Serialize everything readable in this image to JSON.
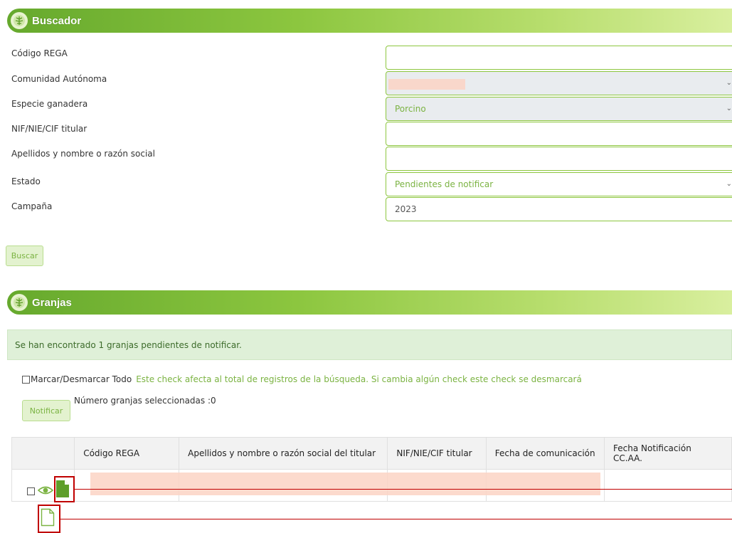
{
  "buscador": {
    "title": "Buscador",
    "fields": [
      {
        "label": "Código REGA",
        "value": "",
        "type": "text"
      },
      {
        "label": "Comunidad Autónoma",
        "value": "",
        "type": "select"
      },
      {
        "label": "Especie ganadera",
        "value": "Porcino",
        "type": "select"
      },
      {
        "label": "NIF/NIE/CIF titular",
        "value": "",
        "type": "text"
      },
      {
        "label": "Apellidos y nombre o razón social",
        "value": "",
        "type": "text"
      },
      {
        "label": "Estado",
        "value": "Pendientes de notificar",
        "type": "select"
      },
      {
        "label": "Campaña",
        "value": "2023",
        "type": "text"
      }
    ],
    "search_button": "Buscar"
  },
  "granjas": {
    "title": "Granjas",
    "alert": "Se han encontrado 1 granjas pendientes de notificar.",
    "toggle_all_label": "Marcar/Desmarcar Todo",
    "toggle_all_note": "Este check afecta al total de registros de la búsqueda. Si cambia algún check este check se desmarcará",
    "selected_count": "Número granjas seleccionadas :0",
    "notify_button": "Notificar",
    "table": {
      "columns": [
        "",
        "Código REGA",
        "Apellidos y nombre o razón social del titular",
        "NIF/NIE/CIF titular",
        "Fecha de comunicación",
        "Fecha Notificación CC.AA."
      ]
    }
  },
  "icons": {
    "section": "leaf-icon",
    "view": "eye-icon",
    "document_filled": "document-filled-icon",
    "document_outline": "document-outline-icon"
  },
  "colors": {
    "accent": "#8cc63f",
    "header_dark": "#66a92d",
    "alert_bg": "#dff0d8",
    "annotation": "#c00000",
    "redaction": "#fbd3c4"
  }
}
